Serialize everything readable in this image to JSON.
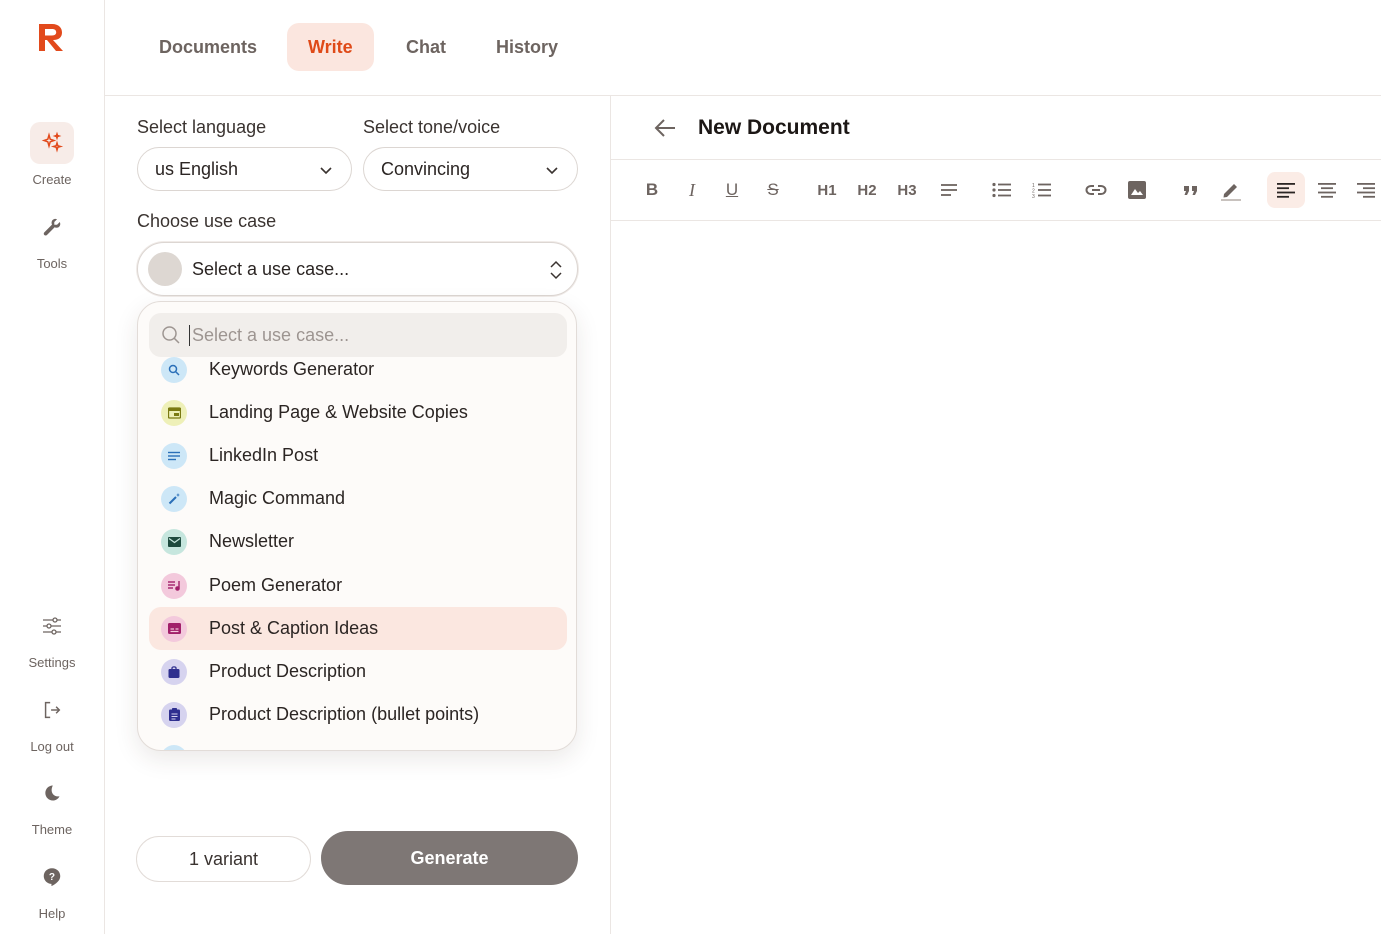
{
  "nav": {
    "items": [
      {
        "label": "Create",
        "icon": "sparkles-icon"
      },
      {
        "label": "Tools",
        "icon": "wrench-icon"
      },
      {
        "label": "Settings",
        "icon": "sliders-icon"
      },
      {
        "label": "Log out",
        "icon": "logout-icon"
      },
      {
        "label": "Theme",
        "icon": "moon-icon"
      },
      {
        "label": "Help",
        "icon": "help-icon"
      }
    ]
  },
  "tabs": [
    {
      "label": "Documents"
    },
    {
      "label": "Write"
    },
    {
      "label": "Chat"
    },
    {
      "label": "History"
    }
  ],
  "form": {
    "language_label": "Select language",
    "language_value": "us English",
    "tone_label": "Select tone/voice",
    "tone_value": "Convincing",
    "usecase_label": "Choose use case",
    "usecase_value": "Select a use case..."
  },
  "dropdown": {
    "search_placeholder": "Select a use case...",
    "items": [
      {
        "label": "Keywords Generator",
        "icon": "magnify-icon",
        "color": "#cde7f7"
      },
      {
        "label": "Landing Page & Website Copies",
        "icon": "webpage-icon",
        "color": "#eef0b8"
      },
      {
        "label": "LinkedIn Post",
        "icon": "text-lines-icon",
        "color": "#cde7f7"
      },
      {
        "label": "Magic Command",
        "icon": "magic-wand-icon",
        "color": "#cde7f7"
      },
      {
        "label": "Newsletter",
        "icon": "envelope-icon",
        "color": "#c6e6de"
      },
      {
        "label": "Poem Generator",
        "icon": "music-lines-icon",
        "color": "#f3c9dc"
      },
      {
        "label": "Post & Caption Ideas",
        "icon": "caption-icon",
        "color": "#f3c9dc"
      },
      {
        "label": "Product Description",
        "icon": "shopping-bag-icon",
        "color": "#d6d3ef"
      },
      {
        "label": "Product Description (bullet points)",
        "icon": "clipboard-list-icon",
        "color": "#d6d3ef"
      }
    ]
  },
  "actions": {
    "variant_label": "1 variant",
    "generate_label": "Generate"
  },
  "editor": {
    "title": "New Document",
    "toolbar": [
      "B",
      "I",
      "U",
      "S",
      "H1",
      "H2",
      "H3"
    ]
  },
  "colors": {
    "accent": "#df4a18",
    "accent_bg": "#fbe6df",
    "generate_bg": "#7e7775"
  }
}
